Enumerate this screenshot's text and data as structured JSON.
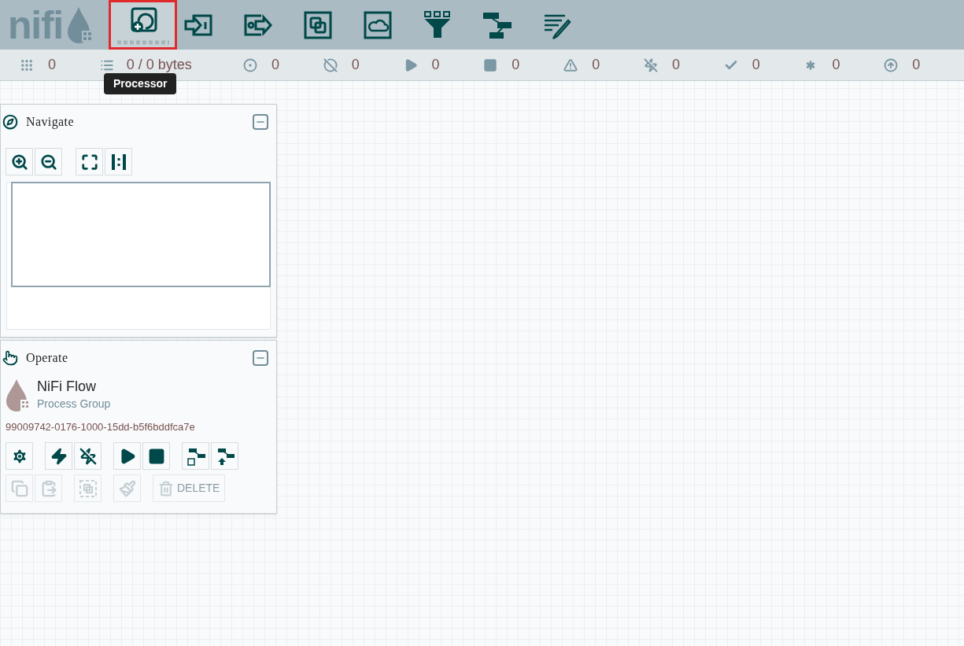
{
  "logo": {
    "text": "nifi"
  },
  "toolbar": [
    {
      "kind": "processor",
      "selected": true
    },
    {
      "kind": "input-port",
      "selected": false
    },
    {
      "kind": "output-port",
      "selected": false
    },
    {
      "kind": "process-group",
      "selected": false
    },
    {
      "kind": "remote-group",
      "selected": false
    },
    {
      "kind": "funnel",
      "selected": false
    },
    {
      "kind": "template",
      "selected": false
    },
    {
      "kind": "label",
      "selected": false
    }
  ],
  "tooltip": "Processor",
  "status_bar": [
    {
      "kind": "threads",
      "value": "0"
    },
    {
      "kind": "queued",
      "value": "0 / 0 bytes"
    },
    {
      "kind": "transmitting",
      "value": "0"
    },
    {
      "kind": "not-transmitting",
      "value": "0"
    },
    {
      "kind": "running",
      "value": "0"
    },
    {
      "kind": "stopped",
      "value": "0"
    },
    {
      "kind": "invalid",
      "value": "0"
    },
    {
      "kind": "disabled",
      "value": "0"
    },
    {
      "kind": "up-to-date",
      "value": "0"
    },
    {
      "kind": "modified",
      "value": "0"
    },
    {
      "kind": "stale",
      "value": "0"
    }
  ],
  "navigate": {
    "title": "Navigate",
    "buttons": [
      {
        "kind": "zoom-in"
      },
      {
        "kind": "zoom-out"
      },
      {
        "kind": "fit"
      },
      {
        "kind": "actual-size"
      }
    ]
  },
  "operate": {
    "title": "Operate",
    "name": "NiFi Flow",
    "type": "Process Group",
    "id": "99009742-0176-1000-15dd-b5f6bddfca7e",
    "rows": [
      [
        {
          "kind": "configure",
          "disabled": false
        },
        {
          "kind": "enable",
          "disabled": false
        },
        {
          "kind": "disable",
          "disabled": false
        },
        {
          "kind": "start",
          "disabled": false
        },
        {
          "kind": "stop",
          "disabled": false
        },
        {
          "kind": "create-template",
          "disabled": false
        },
        {
          "kind": "upload-template",
          "disabled": false
        }
      ],
      [
        {
          "kind": "copy",
          "disabled": true
        },
        {
          "kind": "paste",
          "disabled": true
        },
        {
          "kind": "group",
          "disabled": true
        },
        {
          "kind": "color",
          "disabled": true
        },
        {
          "kind": "delete",
          "disabled": true,
          "label": "DELETE"
        }
      ]
    ]
  }
}
